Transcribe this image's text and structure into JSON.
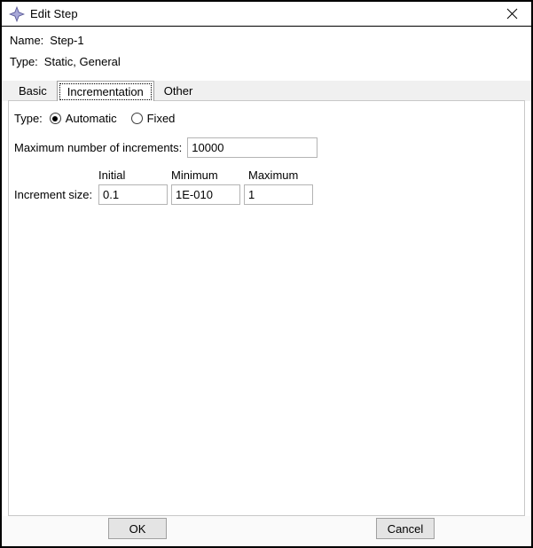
{
  "window": {
    "title": "Edit Step",
    "icon": "step-diamond-icon",
    "close_icon": "close-icon",
    "accent_icon_color": "#8c8cc8"
  },
  "header": {
    "name_label": "Name:",
    "name_value": "Step-1",
    "type_label": "Type:",
    "type_value": "Static, General"
  },
  "tabs": [
    {
      "label": "Basic",
      "selected": false
    },
    {
      "label": "Incrementation",
      "selected": true
    },
    {
      "label": "Other",
      "selected": false
    }
  ],
  "incrementation": {
    "type_label": "Type:",
    "radios": [
      {
        "label": "Automatic",
        "checked": true
      },
      {
        "label": "Fixed",
        "checked": false
      }
    ],
    "max_increments_label": "Maximum number of increments:",
    "max_increments_value": "10000",
    "column_headers": [
      "Initial",
      "Minimum",
      "Maximum"
    ],
    "increment_size_label": "Increment size:",
    "increment_size_values": [
      "0.1",
      "1E-010",
      "1"
    ]
  },
  "footer": {
    "ok_label": "OK",
    "cancel_label": "Cancel"
  }
}
